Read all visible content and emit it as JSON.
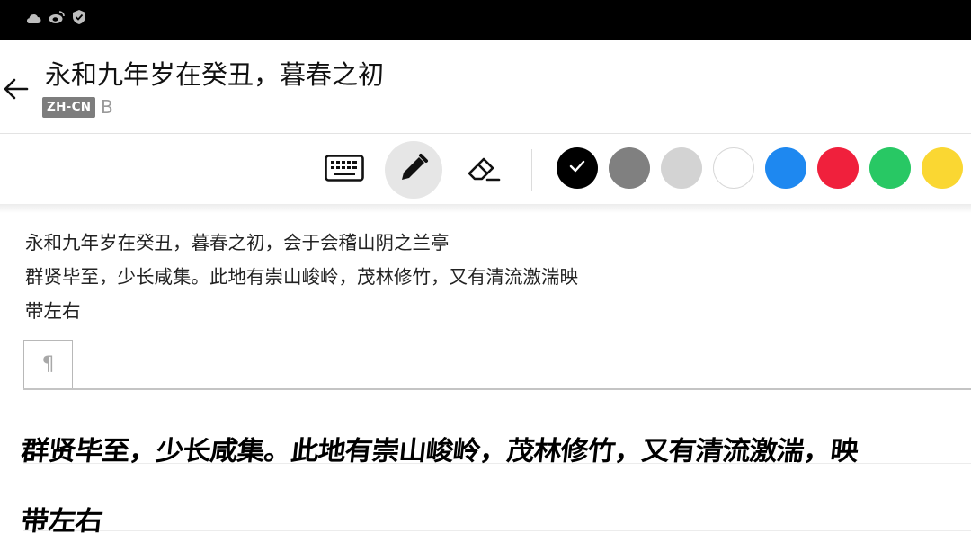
{
  "status_bar": {
    "icons": [
      "cloud-icon",
      "weibo-icon",
      "shield-check-icon"
    ]
  },
  "header": {
    "title": "永和九年岁在癸丑，暮春之初",
    "language": "ZH-CN",
    "sub_label": "B",
    "back_icon": "arrow-left-icon"
  },
  "toolbar": {
    "tools": [
      {
        "name": "keyboard",
        "icon": "keyboard-icon",
        "active": false
      },
      {
        "name": "pen",
        "icon": "pen-icon",
        "active": true
      },
      {
        "name": "eraser",
        "icon": "eraser-icon",
        "active": false
      }
    ],
    "colors": [
      {
        "name": "black",
        "hex": "#000000",
        "selected": true
      },
      {
        "name": "gray",
        "hex": "#808080",
        "selected": false
      },
      {
        "name": "light-gray",
        "hex": "#d3d3d3",
        "selected": false
      },
      {
        "name": "white",
        "hex": "#ffffff",
        "selected": false
      },
      {
        "name": "blue",
        "hex": "#1e88f0",
        "selected": false
      },
      {
        "name": "red",
        "hex": "#f0203c",
        "selected": false
      },
      {
        "name": "green",
        "hex": "#28c864",
        "selected": false
      },
      {
        "name": "yellow",
        "hex": "#fad732",
        "selected": false
      }
    ]
  },
  "recognized_text": {
    "lines": [
      "永和九年岁在癸丑，暮春之初，会于会稽山阴之兰亭",
      "群贤毕至，少长咸集。此地有崇山峻岭，茂林修竹，又有清流激湍映",
      "带左右"
    ]
  },
  "paragraph_marker": "¶",
  "handwriting": {
    "lines": [
      "群贤毕至，少长咸集。此地有崇山峻岭，茂林修竹，又有清流激湍，映",
      "带左右"
    ]
  }
}
